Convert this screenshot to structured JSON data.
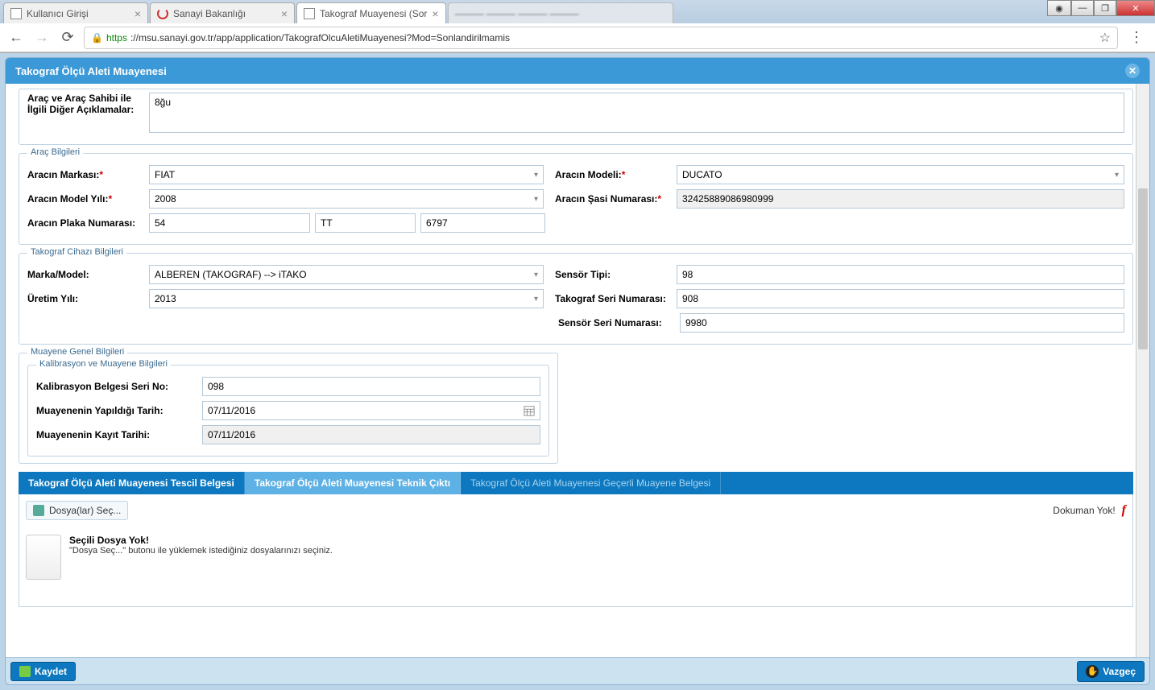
{
  "browser": {
    "tabs": [
      {
        "title": "Kullanıcı Girişi"
      },
      {
        "title": "Sanayi Bakanlığı"
      },
      {
        "title": "Takograf Muayenesi (Sor"
      }
    ],
    "url_secure": "https",
    "url_rest": "://msu.sanayi.gov.tr/app/application/TakografOlcuAletiMuayenesi?Mod=Sonlandirilmamis"
  },
  "panel": {
    "title": "Takograf Ölçü Aleti Muayenesi"
  },
  "owner": {
    "label": "Araç ve Araç Sahibi ile İlgili Diğer Açıklamalar:",
    "value": "8ğu"
  },
  "vehicle": {
    "legend": "Araç Bilgileri",
    "brand_label": "Aracın Markası:",
    "brand": "FIAT",
    "model_label": "Aracın Modeli:",
    "model": "DUCATO",
    "year_label": "Aracın Model Yılı:",
    "year": "2008",
    "chassis_label": "Aracın Şasi Numarası:",
    "chassis": "32425889086980999",
    "plate_label": "Aracın Plaka Numarası:",
    "plate1": "54",
    "plate2": "TT",
    "plate3": "6797"
  },
  "tacho": {
    "legend": "Takograf Cihazı Bilgileri",
    "brand_label": "Marka/Model:",
    "brand": "ALBEREN (TAKOGRAF) --> iTAKO",
    "sensor_type_label": "Sensör Tipi:",
    "sensor_type": "98",
    "year_label": "Üretim Yılı:",
    "year": "2013",
    "serial_label": "Takograf Seri Numarası:",
    "serial": "908",
    "sensor_serial_label": "Sensör Seri Numarası:",
    "sensor_serial": "9980"
  },
  "inspection": {
    "legend_outer": "Muayene Genel Bilgileri",
    "legend_inner": "Kalibrasyon ve Muayene Bilgileri",
    "cert_label": "Kalibrasyon Belgesi Seri No:",
    "cert": "098",
    "date_done_label": "Muayenenin Yapıldığı Tarih:",
    "date_done": "07/11/2016",
    "date_reg_label": "Muayenenin Kayıt Tarihi:",
    "date_reg": "07/11/2016"
  },
  "doc_tabs": {
    "tab1": "Takograf Ölçü Aleti Muayenesi Tescil Belgesi",
    "tab2": "Takograf Ölçü Aleti Muayenesi Teknik Çıktı",
    "tab3": "Takograf Ölçü Aleti Muayenesi Geçerli Muayene Belgesi"
  },
  "docs": {
    "select_files": "Dosya(lar) Seç...",
    "no_doc": "Dokuman Yok!",
    "no_file_title": "Seçili Dosya Yok!",
    "no_file_sub": "\"Dosya Seç...\" butonu ile yüklemek istediğiniz dosyalarınızı seçiniz."
  },
  "footer": {
    "save": "Kaydet",
    "cancel": "Vazgeç"
  }
}
